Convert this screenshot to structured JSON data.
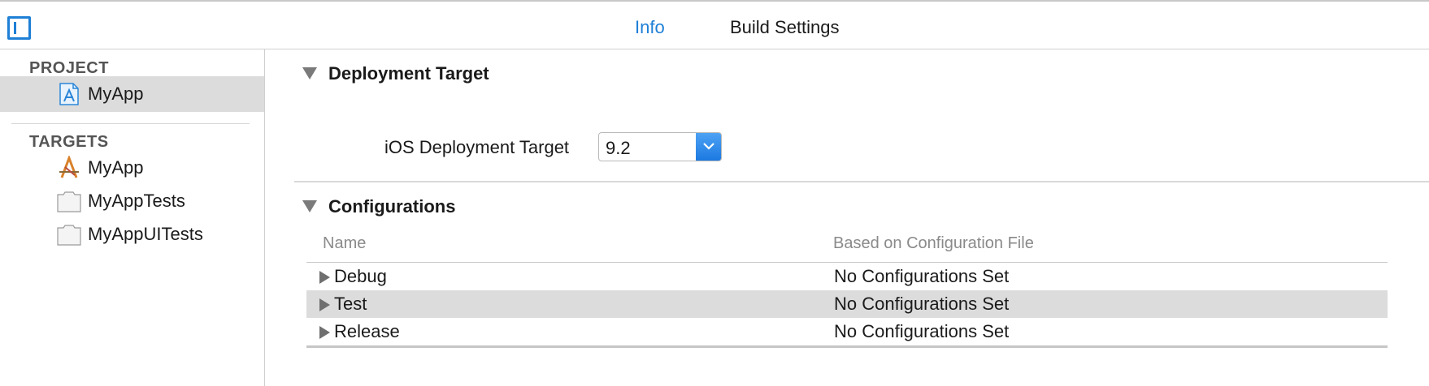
{
  "tabs": [
    {
      "label": "Info",
      "active": true
    },
    {
      "label": "Build Settings",
      "active": false
    }
  ],
  "sidebar": {
    "project_header": "PROJECT",
    "project_item": {
      "label": "MyApp",
      "icon": "project-file-icon",
      "selected": true
    },
    "targets_header": "TARGETS",
    "targets": [
      {
        "label": "MyApp",
        "icon": "app-target-icon"
      },
      {
        "label": "MyAppTests",
        "icon": "test-bundle-icon"
      },
      {
        "label": "MyAppUITests",
        "icon": "test-bundle-icon"
      }
    ]
  },
  "deployment": {
    "section_title": "Deployment Target",
    "label": "iOS Deployment Target",
    "value": "9.2"
  },
  "configurations": {
    "section_title": "Configurations",
    "columns": [
      "Name",
      "Based on Configuration File"
    ],
    "rows": [
      {
        "name": "Debug",
        "file": "No Configurations Set"
      },
      {
        "name": "Test",
        "file": "No Configurations Set"
      },
      {
        "name": "Release",
        "file": "No Configurations Set"
      }
    ]
  },
  "colors": {
    "accent": "#1e7fd6",
    "selected_row": "#dcdcdc"
  }
}
